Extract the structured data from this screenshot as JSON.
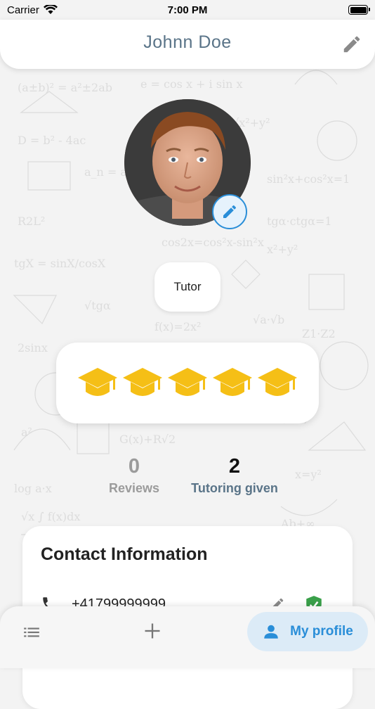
{
  "status_bar": {
    "carrier": "Carrier",
    "time": "7:00 PM"
  },
  "header": {
    "title": "Johnn Doe",
    "edit_icon": "pencil-icon"
  },
  "profile": {
    "role": "Tutor",
    "rating": 5,
    "rating_max": 5,
    "rating_icon": "graduation-cap-icon"
  },
  "stats": [
    {
      "value": "0",
      "label": "Reviews"
    },
    {
      "value": "2",
      "label": "Tutoring given"
    }
  ],
  "contact": {
    "title": "Contact Information",
    "phone": "+41799999999",
    "phone_icon": "phone-icon",
    "verified_icon": "verified-shield-icon"
  },
  "bottom_nav": {
    "list_icon": "list-icon",
    "add_icon": "plus-icon",
    "profile_label": "My profile",
    "profile_icon": "person-icon"
  },
  "colors": {
    "accent": "#2a8ed8",
    "title": "#5a7488",
    "cap": "#f5bf16",
    "verified": "#3aa04a"
  }
}
